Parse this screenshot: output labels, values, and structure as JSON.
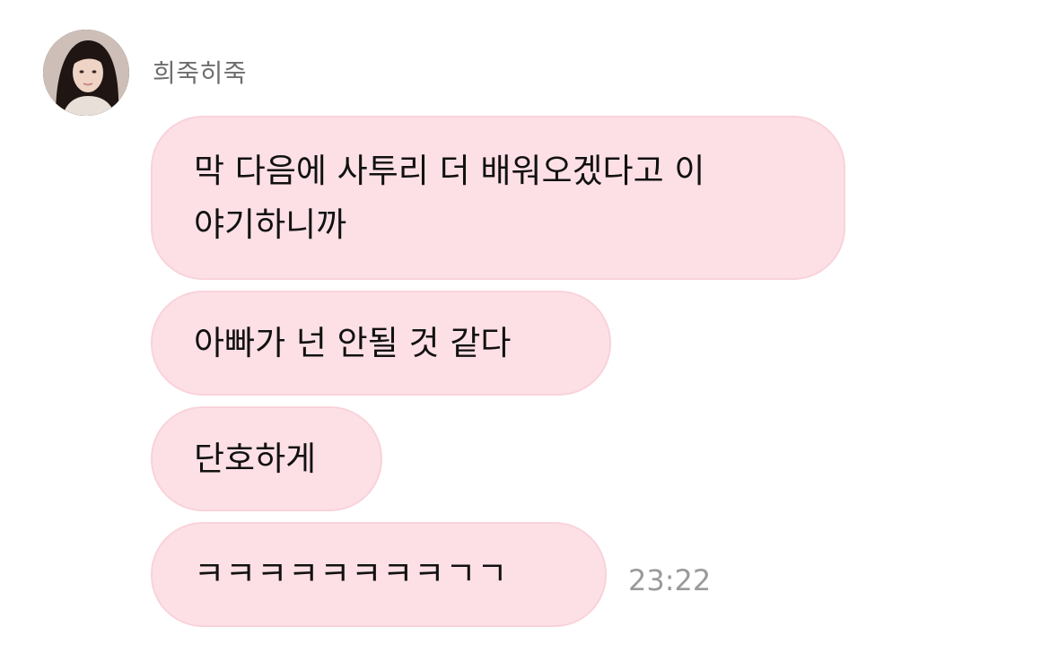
{
  "sender": {
    "name": "희죽히죽",
    "avatar_icon": "profile-photo"
  },
  "messages": [
    {
      "text": "막 다음에 사투리 더 배워오겠다고 이\n야기하니까"
    },
    {
      "text": "아빠가 넌 안될 것 같다"
    },
    {
      "text": "단호하게"
    },
    {
      "text": "ㅋㅋㅋㅋㅋㅋㅋㅋㄱㄱ"
    }
  ],
  "timestamp": "23:22",
  "colors": {
    "bubble_bg": "#fde0e6",
    "bubble_border": "#f9d2da",
    "name_text": "#6e6e6e",
    "time_text": "#9a9a9a"
  }
}
